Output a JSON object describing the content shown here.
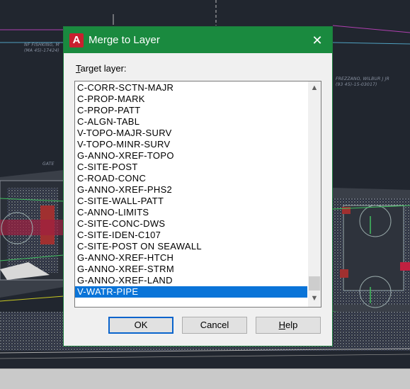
{
  "background": {
    "labels": [
      "NF FISHKING, M",
      "(MA 45)-17424)",
      "GATE",
      "FREZZANO, WILBUR J JR",
      "(93 45)-15-03017)"
    ]
  },
  "dialog": {
    "title": "Merge to Layer",
    "icon": "autocad-app-icon",
    "close_glyph": "✕",
    "target_label_prefix": "T",
    "target_label_rest": "arget layer:",
    "layers": [
      "C-CORR-SCTN-MAJR",
      "C-PROP-MARK",
      "C-PROP-PATT",
      "C-ALGN-TABL",
      "V-TOPO-MAJR-SURV",
      "V-TOPO-MINR-SURV",
      "G-ANNO-XREF-TOPO",
      "C-SITE-POST",
      "C-ROAD-CONC",
      "G-ANNO-XREF-PHS2",
      "C-SITE-WALL-PATT",
      "C-ANNO-LIMITS",
      "C-SITE-CONC-DWS",
      "C-SITE-IDEN-C107",
      "C-SITE-POST ON SEAWALL",
      "G-ANNO-XREF-HTCH",
      "G-ANNO-XREF-STRM",
      "G-ANNO-XREF-LAND",
      "V-WATR-PIPE"
    ],
    "selected_layer": "V-WATR-PIPE",
    "buttons": {
      "ok": "OK",
      "cancel": "Cancel",
      "help_prefix": "H",
      "help_rest": "elp"
    }
  },
  "colors": {
    "titlebar": "#1a8a3f",
    "selection": "#0a74d8"
  }
}
